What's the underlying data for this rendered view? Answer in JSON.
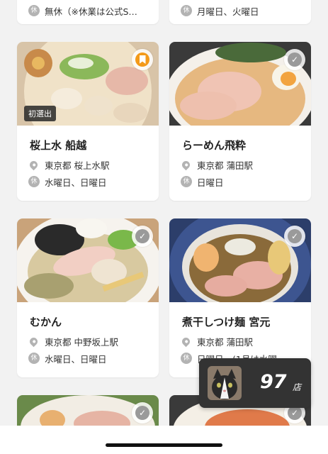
{
  "top_cards": [
    {
      "holiday": "無休（※休業は公式S…"
    },
    {
      "holiday": "月曜日、火曜日"
    }
  ],
  "cards": [
    {
      "name": "桜上水 船越",
      "station": "東京都 桜上水駅",
      "holiday": "水曜日、日曜日",
      "tag": "初選出",
      "bookmarked": true
    },
    {
      "name": "らーめん飛粋",
      "station": "東京都 蒲田駅",
      "holiday": "日曜日",
      "bookmarked": false
    },
    {
      "name": "むかん",
      "station": "東京都 中野坂上駅",
      "holiday": "水曜日、日曜日",
      "bookmarked": false
    },
    {
      "name": "煮干しつけ麺 宮元",
      "station": "東京都 蒲田駅",
      "holiday": "日曜日、(1月は水曜…",
      "bookmarked": false
    }
  ],
  "icons": {
    "location": "pin-icon",
    "holiday": "休",
    "visited": "check-icon",
    "bookmark": "bookmark-icon"
  },
  "counter": {
    "value": "97",
    "unit": "店"
  },
  "colors": {
    "accent": "#f39a1a",
    "icon_gray": "#b3b3b3",
    "counter_bg": "#333333"
  }
}
